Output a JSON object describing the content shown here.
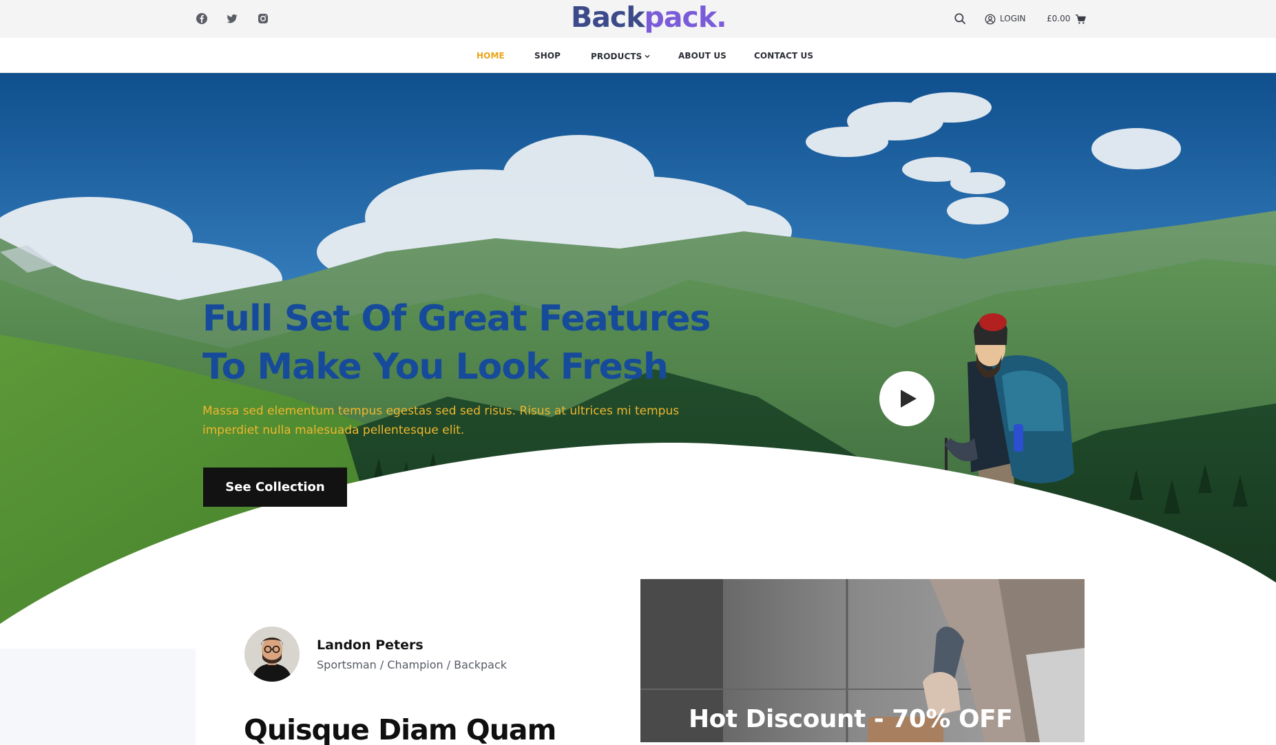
{
  "header": {
    "social": [
      {
        "name": "facebook",
        "icon": "facebook-icon"
      },
      {
        "name": "twitter",
        "icon": "twitter-icon"
      },
      {
        "name": "instagram",
        "icon": "instagram-icon"
      }
    ],
    "logo_part1": "Back",
    "logo_part2": "pack.",
    "login_label": "LOGIN",
    "cart_total": "£0.00",
    "colors": {
      "logo_primary": "#3c4a8a",
      "logo_accent": "#7a5cd8"
    }
  },
  "nav": {
    "items": [
      {
        "label": "HOME",
        "active": true
      },
      {
        "label": "SHOP",
        "active": false
      },
      {
        "label": "PRODUCTS",
        "active": false,
        "has_dropdown": true
      },
      {
        "label": "ABOUT US",
        "active": false
      },
      {
        "label": "CONTACT US",
        "active": false
      }
    ],
    "active_color": "#e8a418"
  },
  "hero": {
    "title_line1": "Full Set Of Great Features",
    "title_line2": "To Make You Look Fresh",
    "subtitle": "Massa sed elementum tempus egestas sed sed risus. Risus at ultrices mi tempus imperdiet nulla malesuada pellentesque elit.",
    "button_label": "See Collection",
    "play_icon": "play-icon",
    "colors": {
      "title": "#164a9a",
      "subtitle": "#f0b62d",
      "button_bg": "#121212"
    }
  },
  "profile": {
    "name": "Landon Peters",
    "role": "Sportsman / Champion / Backpack"
  },
  "section": {
    "title": "Quisque Diam Quam"
  },
  "promo": {
    "text": "Hot Discount - 70% OFF"
  }
}
